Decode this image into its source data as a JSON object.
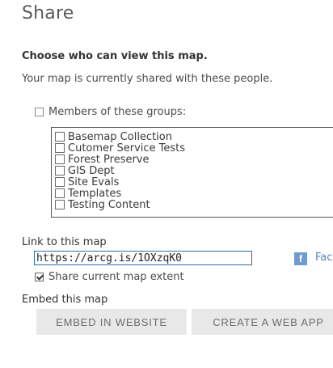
{
  "dialog": {
    "title": "Share"
  },
  "visibility": {
    "heading": "Choose who can view this map.",
    "status_text": "Your map is currently shared with these people.",
    "groups_label": "Members of these groups:",
    "groups_checked": false,
    "groups": [
      {
        "label": "Basemap Collection",
        "checked": false
      },
      {
        "label": "Cutomer Service Tests",
        "checked": false
      },
      {
        "label": "Forest Preserve",
        "checked": false
      },
      {
        "label": "GIS Dept",
        "checked": false
      },
      {
        "label": "Site Evals",
        "checked": false
      },
      {
        "label": "Templates",
        "checked": false
      },
      {
        "label": "Testing Content",
        "checked": false
      }
    ]
  },
  "link": {
    "heading": "Link to this map",
    "url": "https://arcg.is/1OXzqK0",
    "facebook_icon": "f",
    "facebook_label": "Fac",
    "share_extent_label": "Share current map extent",
    "share_extent_checked": true
  },
  "embed": {
    "heading": "Embed this map",
    "embed_button": "EMBED IN WEBSITE",
    "webapp_button": "CREATE A WEB APP"
  },
  "colors": {
    "input_border": "#2d6ea0",
    "facebook_blue": "#6f9bd1",
    "button_bg": "#e8e8e8"
  }
}
